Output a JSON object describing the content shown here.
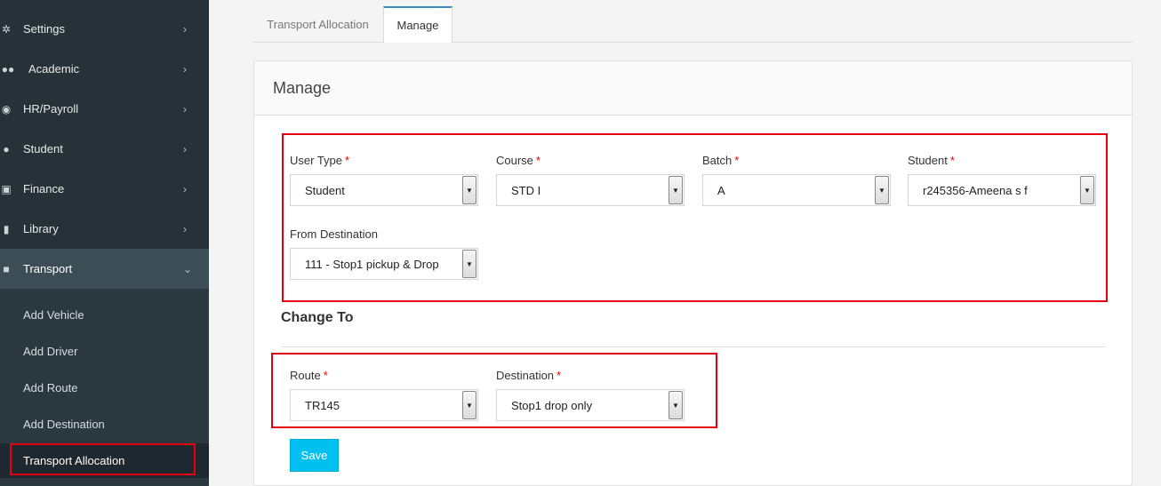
{
  "sidebar": {
    "items": [
      {
        "label": "Settings",
        "icon": "gear-icon"
      },
      {
        "label": "Academic",
        "icon": "users-icon"
      },
      {
        "label": "HR/Payroll",
        "icon": "eye-icon"
      },
      {
        "label": "Student",
        "icon": "user-icon"
      },
      {
        "label": "Finance",
        "icon": "money-icon"
      },
      {
        "label": "Library",
        "icon": "book-icon"
      },
      {
        "label": "Transport",
        "icon": "truck-icon"
      }
    ],
    "sub_items": [
      "Add Vehicle",
      "Add Driver",
      "Add Route",
      "Add Destination",
      "Transport Allocation"
    ]
  },
  "tabs": [
    "Transport Allocation",
    "Manage"
  ],
  "panel": {
    "title": "Manage",
    "fields": {
      "user_type": {
        "label": "User Type",
        "required": "*",
        "value": "Student"
      },
      "course": {
        "label": "Course",
        "required": "*",
        "value": "STD I"
      },
      "batch": {
        "label": "Batch",
        "required": "*",
        "value": "A"
      },
      "student": {
        "label": "Student",
        "required": "*",
        "value": "r245356-Ameena s f"
      },
      "from_destination": {
        "label": "From Destination",
        "value": "111 - Stop1 pickup & Drop"
      }
    },
    "change_to": {
      "title": "Change To",
      "route": {
        "label": "Route",
        "required": "*",
        "value": "TR145"
      },
      "destination": {
        "label": "Destination",
        "required": "*",
        "value": "Stop1 drop only"
      }
    },
    "save_label": "Save"
  },
  "colors": {
    "sidebar_bg": "#263238",
    "accent": "#00c0ef",
    "highlight": "#e4000f"
  }
}
